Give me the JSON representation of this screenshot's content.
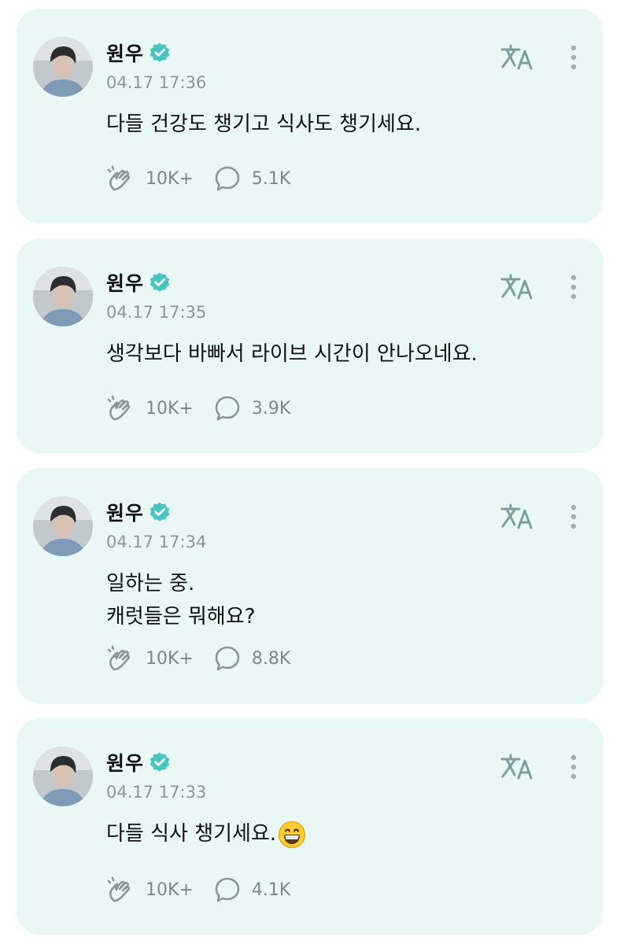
{
  "colors": {
    "card_background": "#e9f8f5",
    "accent": "#45c7c0",
    "icon_gray": "#9aa1a6",
    "text_primary": "#111111",
    "text_secondary": "#8e9499"
  },
  "icons": {
    "verified": "verified-badge-icon",
    "translate": "translate-icon",
    "more": "more-vertical-icon",
    "like": "applause-hands-icon",
    "comment": "comment-bubble-icon"
  },
  "posts": [
    {
      "author": "원우",
      "timestamp": "04.17 17:36",
      "text": "다들 건강도 챙기고 식사도 챙기세요.",
      "likes": "10K+",
      "comments": "5.1K"
    },
    {
      "author": "원우",
      "timestamp": "04.17 17:35",
      "text": "생각보다 바빠서 라이브 시간이 안나오네요.",
      "likes": "10K+",
      "comments": "3.9K"
    },
    {
      "author": "원우",
      "timestamp": "04.17 17:34",
      "text": "일하는 중.\n캐럿들은 뭐해요?",
      "likes": "10K+",
      "comments": "8.8K"
    },
    {
      "author": "원우",
      "timestamp": "04.17 17:33",
      "text": "다들 식사 챙기세요.",
      "emoji": "grinning-face-emoji",
      "likes": "10K+",
      "comments": "4.1K"
    }
  ]
}
